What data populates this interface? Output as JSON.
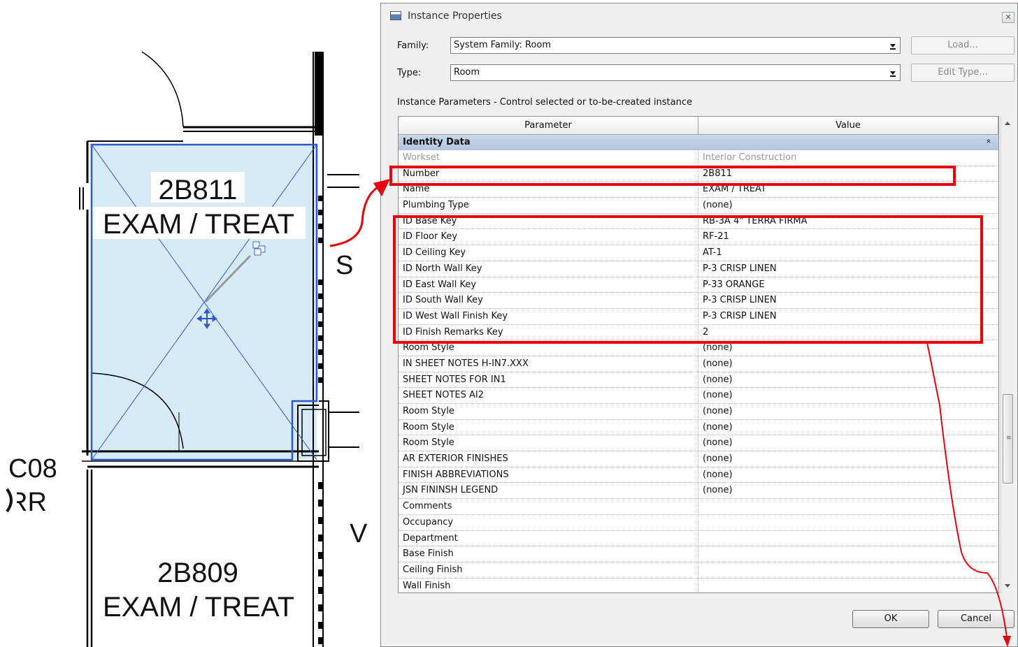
{
  "floor_plan": {
    "room_top_number": "2B811",
    "room_top_name": "EXAM / TREAT",
    "room_bottom_number": "2B809",
    "room_bottom_name": "EXAM / TREAT",
    "left_tag_top": "C08",
    "left_tag_bottom": "RR",
    "corridor_letter_s": "S",
    "corridor_letter_v": "V",
    "selection_color": "#2f58c8",
    "room_fill_color": "#d6ebf6"
  },
  "dialog": {
    "title": "Instance Properties",
    "close_label": "✕",
    "family_label": "Family:",
    "family_value": "System Family: Room",
    "type_label": "Type:",
    "type_value": "Room",
    "load_label": "Load...",
    "edit_type_label": "Edit Type...",
    "params_caption": "Instance Parameters - Control selected or to-be-created instance",
    "col_parameter": "Parameter",
    "col_value": "Value",
    "group_label": "Identity Data",
    "group_collapse_icon": "»",
    "ok_label": "OK",
    "cancel_label": "Cancel",
    "highlight_color": "#e8000b",
    "rows": [
      {
        "param": "Workset",
        "value": "Interior Construction",
        "dim": true
      },
      {
        "param": "Number",
        "value": "2B811"
      },
      {
        "param": "Name",
        "value": "EXAM / TREAT"
      },
      {
        "param": "Plumbing Type",
        "value": "(none)"
      },
      {
        "param": "ID Base Key",
        "value": "RB-3A 4\" TERRA FIRMA"
      },
      {
        "param": "ID Floor Key",
        "value": "RF-21"
      },
      {
        "param": "ID Ceiling Key",
        "value": "AT-1"
      },
      {
        "param": "ID North Wall Key",
        "value": "P-3 CRISP LINEN"
      },
      {
        "param": "ID East Wall Key",
        "value": "P-33 ORANGE"
      },
      {
        "param": "ID South Wall Key",
        "value": "P-3 CRISP LINEN"
      },
      {
        "param": "ID West Wall Finish Key",
        "value": "P-3 CRISP LINEN"
      },
      {
        "param": "ID Finish Remarks Key",
        "value": "2"
      },
      {
        "param": "Room Style",
        "value": "(none)"
      },
      {
        "param": "IN SHEET NOTES H-IN7.XXX",
        "value": "(none)"
      },
      {
        "param": "SHEET NOTES FOR IN1",
        "value": "(none)"
      },
      {
        "param": "SHEET NOTES AI2",
        "value": "(none)"
      },
      {
        "param": "Room Style",
        "value": "(none)"
      },
      {
        "param": "Room Style",
        "value": "(none)"
      },
      {
        "param": "Room Style",
        "value": "(none)"
      },
      {
        "param": "AR EXTERIOR FINISHES",
        "value": "(none)"
      },
      {
        "param": "FINISH ABBREVIATIONS",
        "value": "(none)"
      },
      {
        "param": "JSN FININSH LEGEND",
        "value": "(none)"
      },
      {
        "param": "Comments",
        "value": ""
      },
      {
        "param": "Occupancy",
        "value": ""
      },
      {
        "param": "Department",
        "value": ""
      },
      {
        "param": "Base Finish",
        "value": ""
      },
      {
        "param": "Ceiling Finish",
        "value": ""
      },
      {
        "param": "Wall Finish",
        "value": ""
      }
    ]
  }
}
